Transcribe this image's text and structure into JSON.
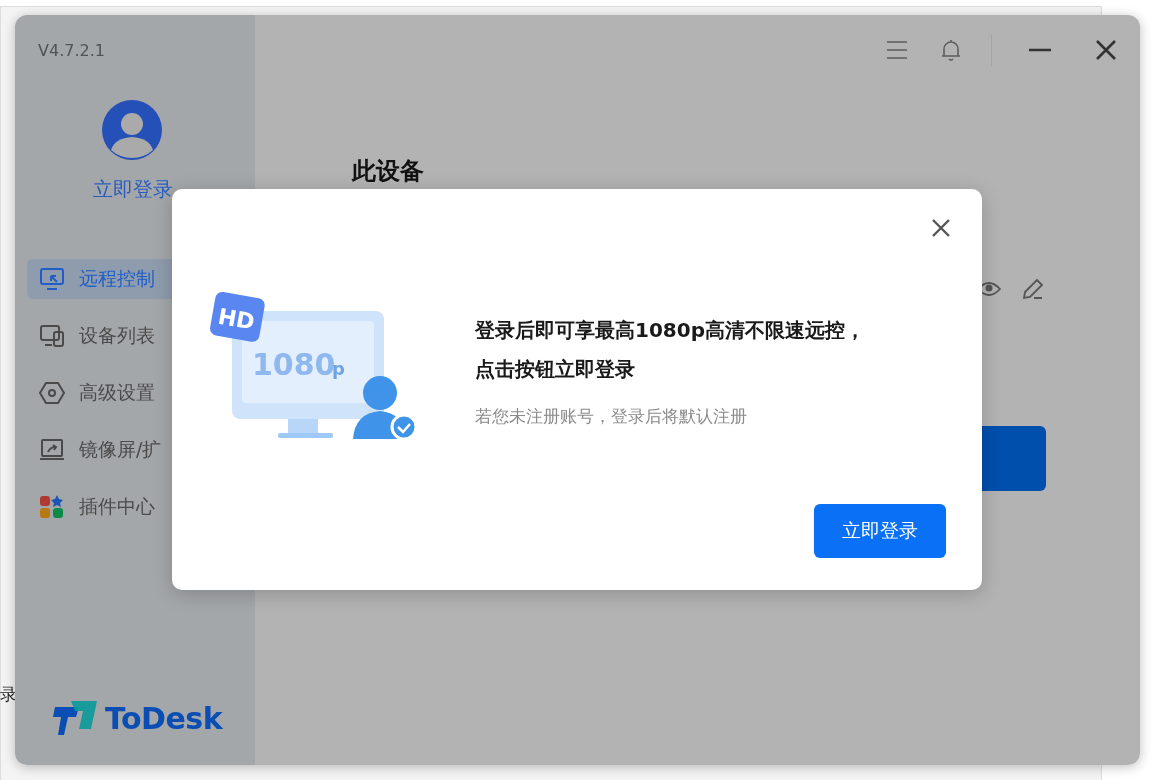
{
  "background_window": {
    "fragment": "录"
  },
  "window": {
    "version": "V4.7.2.1"
  },
  "account": {
    "login_link": "立即登录"
  },
  "nav": [
    {
      "label": "远程控制",
      "selected": true
    },
    {
      "label": "设备列表",
      "selected": false
    },
    {
      "label": "高级设置",
      "selected": false
    },
    {
      "label": "镜像屏/扩",
      "selected": false
    },
    {
      "label": "插件中心",
      "selected": false
    }
  ],
  "brand": "ToDesk",
  "main": {
    "heading": "此设备"
  },
  "dialog": {
    "illustration": {
      "badge": "HD",
      "label": "1080",
      "suffix": "p"
    },
    "headline": [
      "登录后即可享最高1080p高清不限速远控，",
      "点击按钮立即登录"
    ],
    "note": "若您未注册账号，登录后将默认注册",
    "button": "立即登录"
  }
}
